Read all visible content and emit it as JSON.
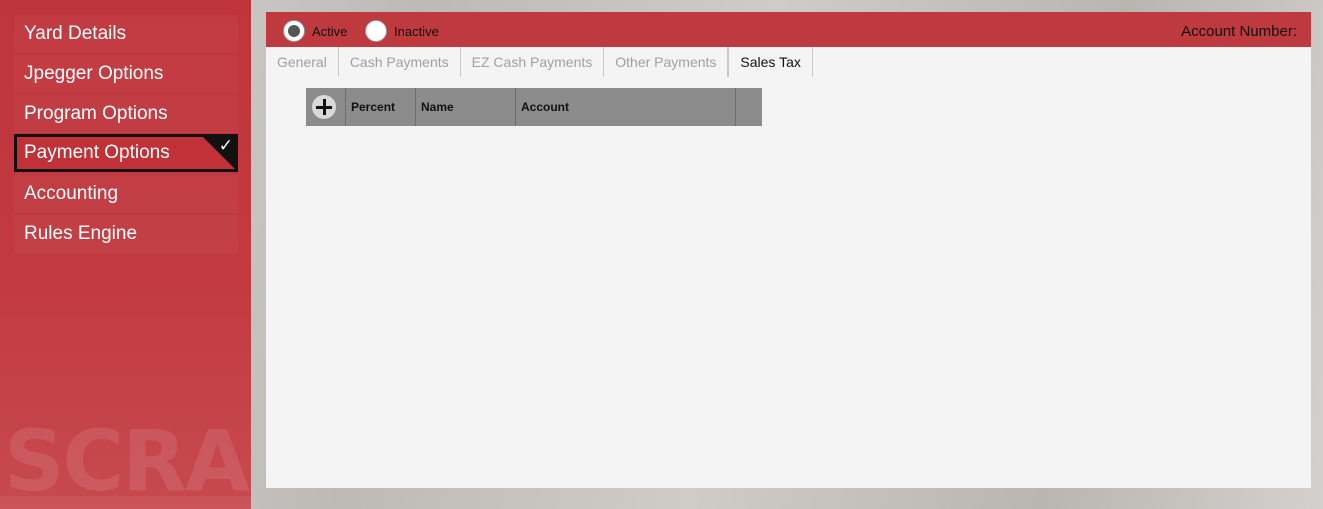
{
  "sidebar": {
    "items": [
      {
        "label": "Yard Details"
      },
      {
        "label": "Jpegger Options"
      },
      {
        "label": "Program Options"
      },
      {
        "label": "Payment Options",
        "selected": true
      },
      {
        "label": "Accounting"
      },
      {
        "label": "Rules Engine"
      }
    ],
    "selected_icon": "checkmark-icon",
    "watermark": "SCRAP"
  },
  "status": {
    "active_label": "Active",
    "inactive_label": "Inactive",
    "selected": "Active"
  },
  "header": {
    "account_label": "Account Number:"
  },
  "tabs": [
    {
      "label": "General",
      "active": false
    },
    {
      "label": "Cash Payments",
      "active": false
    },
    {
      "label": "EZ Cash Payments",
      "active": false
    },
    {
      "label": "Other Payments",
      "active": false
    },
    {
      "label": "Sales Tax",
      "active": true
    }
  ],
  "grid": {
    "add_icon": "plus-icon",
    "columns": [
      "Percent",
      "Name",
      "Account",
      ""
    ],
    "rows": []
  },
  "colors": {
    "sidebar": "#c1383d",
    "accent": "#bf3a3e",
    "grid_header": "#8c8c8c"
  }
}
